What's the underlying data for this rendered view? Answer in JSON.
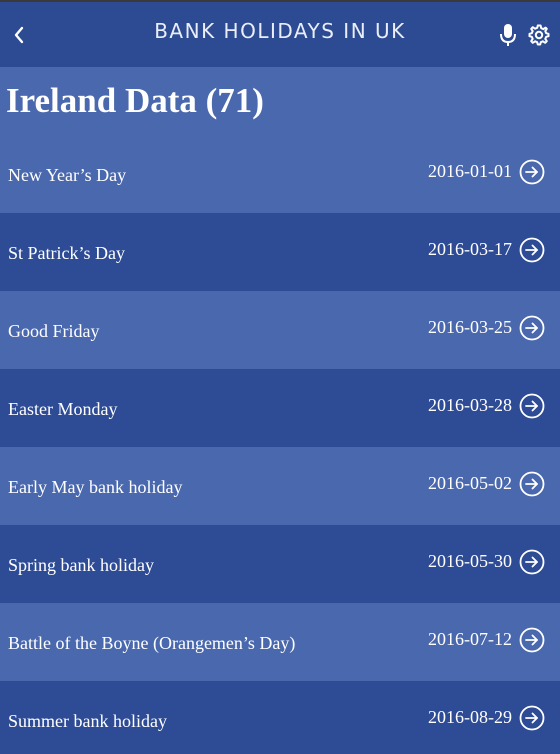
{
  "header": {
    "title": "BANK HOLIDAYS IN UK",
    "back_icon": "chevron-left-icon",
    "mic_icon": "microphone-icon",
    "settings_icon": "gear-icon"
  },
  "page": {
    "title": "Ireland Data (71)"
  },
  "holidays": [
    {
      "name": "New Year’s Day",
      "date": "2016-01-01"
    },
    {
      "name": "St Patrick’s Day",
      "date": "2016-03-17"
    },
    {
      "name": "Good Friday",
      "date": "2016-03-25"
    },
    {
      "name": "Easter Monday",
      "date": "2016-03-28"
    },
    {
      "name": "Early May bank holiday",
      "date": "2016-05-02"
    },
    {
      "name": "Spring bank holiday",
      "date": "2016-05-30"
    },
    {
      "name": "Battle of the Boyne (Orangemen’s Day)",
      "date": "2016-07-12"
    },
    {
      "name": "Summer bank holiday",
      "date": "2016-08-29"
    }
  ],
  "colors": {
    "topbar": "#2c4b93",
    "row_light": "#4a68ad",
    "row_dark": "#2e4b95",
    "text": "#ffffff"
  }
}
